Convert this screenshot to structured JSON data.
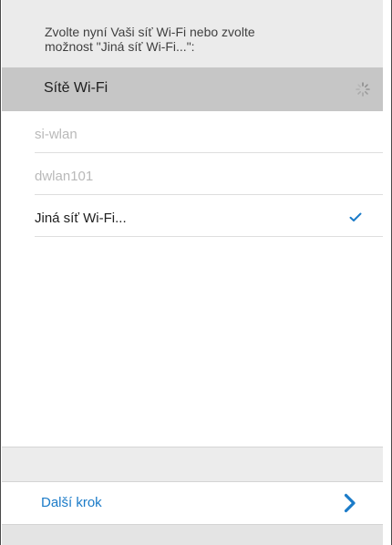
{
  "intro": {
    "line1": "Zvolte nyní Vaši síť Wi-Fi nebo zvolte",
    "line2": "možnost \"Jiná síť Wi-Fi...\":"
  },
  "section": {
    "title": "Sítě Wi-Fi",
    "status_icon": "loading-spinner-icon"
  },
  "networks": [
    {
      "label": "si-wlan",
      "dimmed": true,
      "checked": false
    },
    {
      "label": "dwlan101",
      "dimmed": true,
      "checked": false
    },
    {
      "label": "Jiná síť Wi-Fi...",
      "dimmed": false,
      "checked": true
    }
  ],
  "footer": {
    "next_label": "Další krok",
    "next_icon": "chevron-right-icon"
  },
  "colors": {
    "accent": "#1b7bc8",
    "header_bg": "#c6c6c6",
    "intro_bg": "#ebebeb",
    "dimmed_text": "#b9b9b9"
  }
}
